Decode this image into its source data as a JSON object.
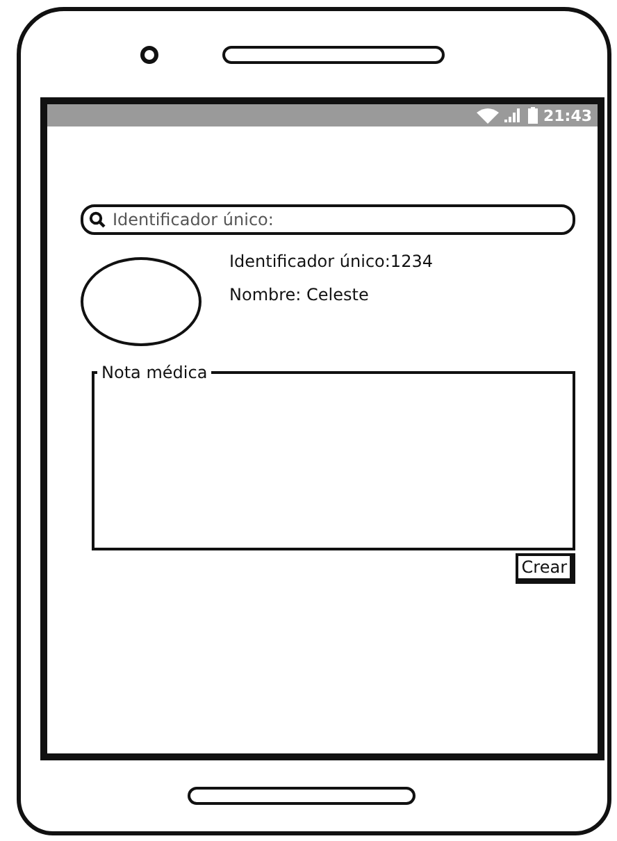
{
  "status_bar": {
    "time": "21:43"
  },
  "search": {
    "placeholder": "Identificador único:"
  },
  "profile": {
    "id_line": "Identificador único:1234",
    "name_line": "Nombre: Celeste"
  },
  "note": {
    "legend": "Nota médica"
  },
  "buttons": [
    "Crear"
  ]
}
